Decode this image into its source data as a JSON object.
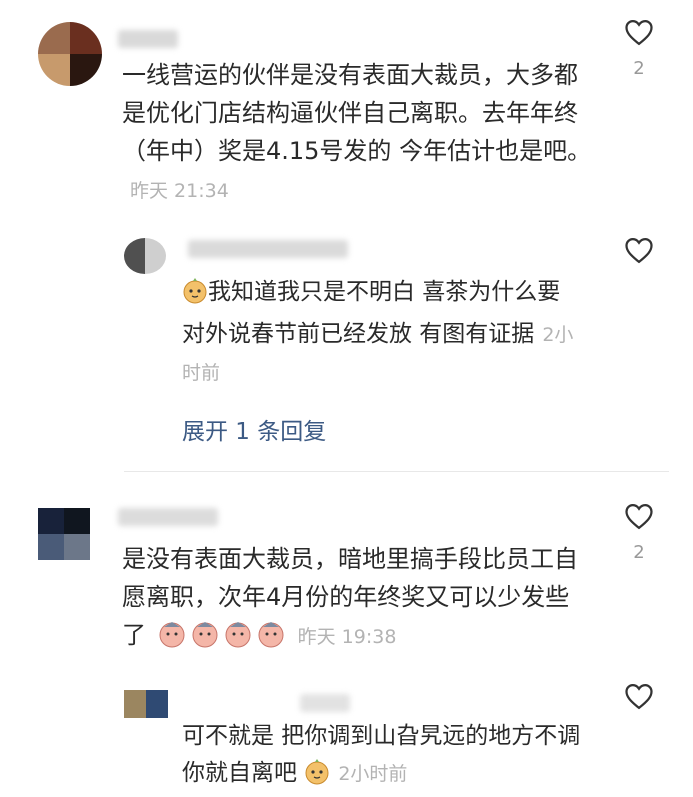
{
  "comments": [
    {
      "text": "一线营运的伙伴是没有表面大裁员，大多都是优化门店结构逼伙伴自己离职。去年年终（年中）奖是4.15号发的 今年估计也是吧。",
      "time": "昨天 21:34",
      "likes": "2",
      "reply": {
        "text": "我知道我只是不明白 喜茶为什么要对外说春节前已经发放 有图有证据",
        "time": "2小时前"
      },
      "expand_label": "展开 1 条回复"
    },
    {
      "text": "是没有表面大裁员，暗地里搞手段比员工自愿离职，次年4月份的年终奖又可以少发些了",
      "time": "昨天 19:38",
      "likes": "2",
      "reply": {
        "text": "可不就是 把你调到山旮旯远的地方不调你就自离吧",
        "time": "2小时前"
      }
    }
  ],
  "icons": {
    "like": "heart-outline-icon",
    "emoji": "face-emoji-icon"
  },
  "colors": {
    "link": "#3c5a84",
    "meta": "#b3b3b3"
  }
}
